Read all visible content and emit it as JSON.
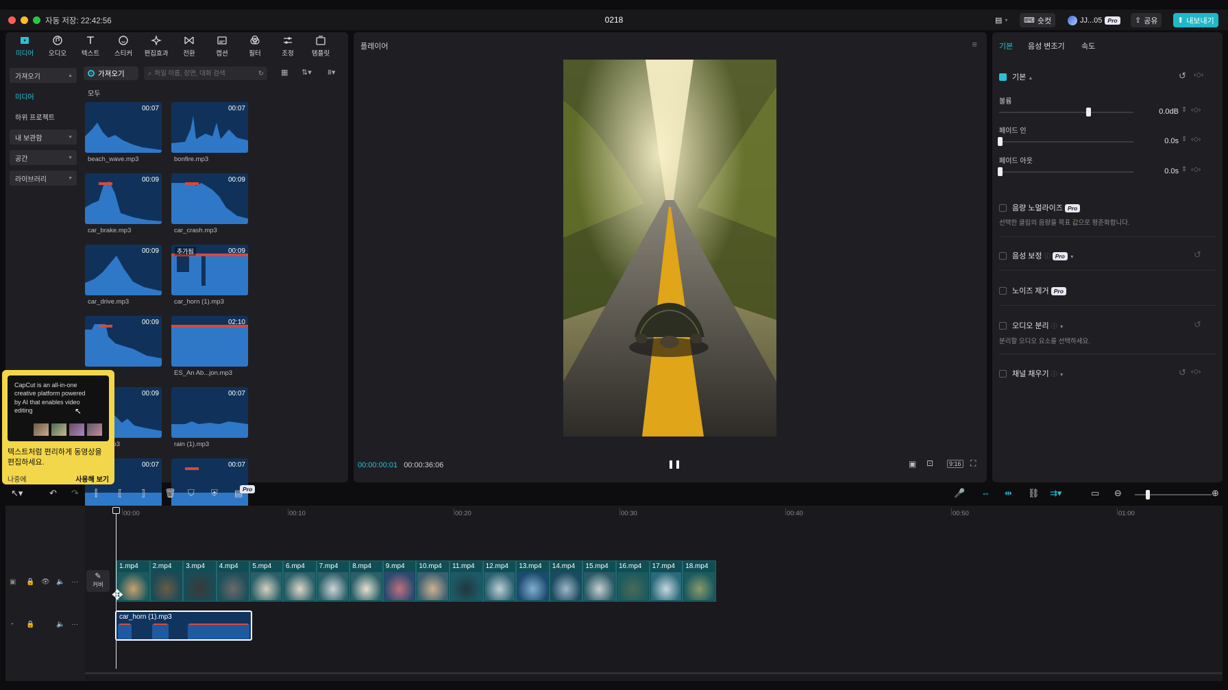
{
  "window": {
    "autosave": "자동 저장: 22:42:56",
    "project_title": "0218",
    "shortcut_label": "숏컷",
    "user_label": "JJ...05",
    "pro_label": "Pro",
    "share_label": "공유",
    "export_label": "내보내기"
  },
  "toolbar": [
    {
      "label": "미디어",
      "icon": "media-icon"
    },
    {
      "label": "오디오",
      "icon": "audio-icon"
    },
    {
      "label": "텍스트",
      "icon": "text-icon"
    },
    {
      "label": "스티커",
      "icon": "sticker-icon"
    },
    {
      "label": "편집효과",
      "icon": "effect-icon"
    },
    {
      "label": "전환",
      "icon": "transition-icon"
    },
    {
      "label": "캡션",
      "icon": "caption-icon"
    },
    {
      "label": "필터",
      "icon": "filter-icon"
    },
    {
      "label": "조정",
      "icon": "adjust-icon"
    },
    {
      "label": "템플릿",
      "icon": "template-icon"
    }
  ],
  "sidenav": {
    "import": "가져오기",
    "media": "미디어",
    "sub_project": "하위 프로젝트",
    "my_storage": "내 보관함",
    "space": "공간",
    "library": "라이브러리"
  },
  "media": {
    "import_button": "가져오기",
    "search_placeholder": "파일 이름, 장면, 대화 검색",
    "all_label": "모두",
    "added_badge": "추가됨",
    "items": [
      {
        "name": "beach_wave.mp3",
        "duration": "00:07"
      },
      {
        "name": "bonfire.mp3",
        "duration": "00:07"
      },
      {
        "name": "car_brake.mp3",
        "duration": "00:09"
      },
      {
        "name": "car_crash.mp3",
        "duration": "00:09"
      },
      {
        "name": "car_drive.mp3",
        "duration": "00:09"
      },
      {
        "name": "car_horn (1).mp3",
        "duration": "00:09"
      },
      {
        "name": "...m.mp3",
        "duration": "00:09"
      },
      {
        "name": "ES_An Ab...jon.mp3",
        "duration": "02:10"
      },
      {
        "name": "sound.mp3",
        "duration": "00:09"
      },
      {
        "name": "rain (1).mp3",
        "duration": "00:07"
      },
      {
        "name": "",
        "duration": "00:07"
      },
      {
        "name": "",
        "duration": "00:07"
      }
    ]
  },
  "tooltip": {
    "card_text": "CapCut is an all-in-one creative platform powered by AI that enables video editing",
    "message": "텍스트처럼 편리하게 동영상을 편집하세요.",
    "later": "나중에",
    "try": "사용해 보기"
  },
  "player": {
    "title": "플레이어",
    "current_time": "00:00:00:01",
    "total_time": "00:00:36:06",
    "ratio": "9:16"
  },
  "right_panel": {
    "tabs": [
      "기본",
      "음성 변조기",
      "속도"
    ],
    "basic_section": "기본",
    "volume": {
      "label": "볼륨",
      "value": "0.0dB",
      "level": 0.66
    },
    "fade_in": {
      "label": "페이드 인",
      "value": "0.0s",
      "level": 0.0
    },
    "fade_out": {
      "label": "페이드 아웃",
      "value": "0.0s",
      "level": 0.0
    },
    "normalize": {
      "label": "음량 노멀라이즈",
      "desc": "선택한 클립의 음량을 목표 값으로 평준화합니다."
    },
    "voice_enhance": {
      "label": "음성 보정"
    },
    "noise_remove": {
      "label": "노이즈 제거"
    },
    "audio_split": {
      "label": "오디오 분리",
      "desc": "분리할 오디오 요소를 선택하세요."
    },
    "channel_fill": {
      "label": "채널 채우기"
    }
  },
  "timeline": {
    "ruler": [
      "00:00",
      "00:10",
      "00:20",
      "00:30",
      "00:40",
      "00:50",
      "01:00"
    ],
    "cover_label": "커버",
    "clips": [
      "1.mp4",
      "2.mp4",
      "3.mp4",
      "4.mp4",
      "5.mp4",
      "6.mp4",
      "7.mp4",
      "8.mp4",
      "9.mp4",
      "10.mp4",
      "11.mp4",
      "12.mp4",
      "13.mp4",
      "14.mp4",
      "15.mp4",
      "16.mp4",
      "17.mp4",
      "18.mp4"
    ],
    "audio_clip": "car_horn (1).mp3"
  },
  "colors": {
    "accent": "#2ac0d6",
    "export": "#1fb8c9",
    "audio_blue": "#10325a",
    "clip_teal": "#0f4e55",
    "tooltip_yellow": "#f3d74a"
  }
}
